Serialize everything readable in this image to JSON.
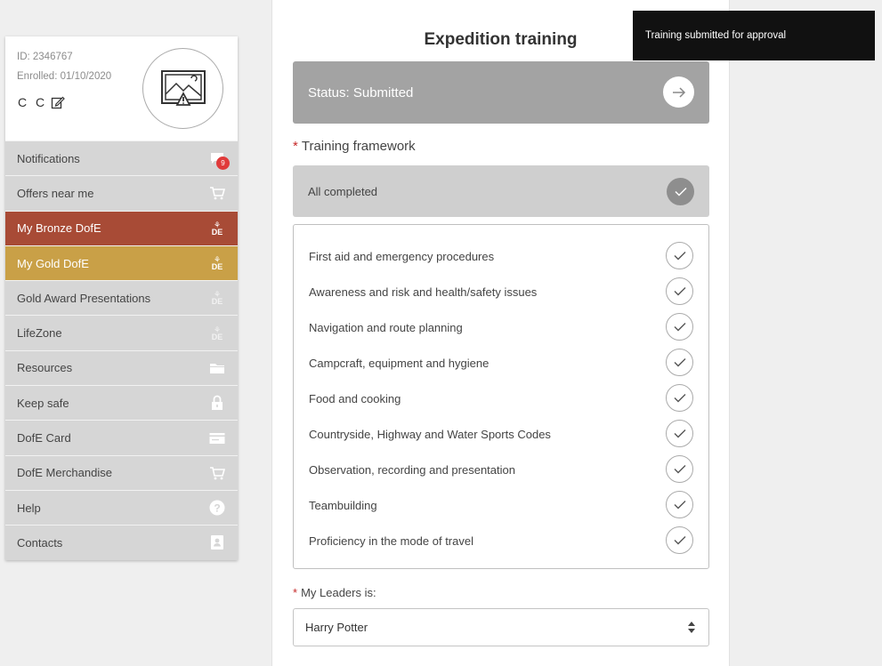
{
  "profile": {
    "id_text": "ID: 2346767",
    "enrolled_text": "Enrolled: 01/10/2020",
    "name": "C C",
    "avatar_icon": "broken-image-icon"
  },
  "nav": {
    "items": [
      {
        "label": "Notifications",
        "icon": "message-icon",
        "badge": "9"
      },
      {
        "label": "Offers near me",
        "icon": "cart-icon"
      },
      {
        "label": "My Bronze DofE",
        "icon": "dofe-logo-icon"
      },
      {
        "label": "My Gold DofE",
        "icon": "dofe-logo-icon"
      },
      {
        "label": "Gold Award Presentations",
        "icon": "dofe-logo-icon"
      },
      {
        "label": "LifeZone",
        "icon": "dofe-logo-icon"
      },
      {
        "label": "Resources",
        "icon": "folder-icon"
      },
      {
        "label": "Keep safe",
        "icon": "lock-icon"
      },
      {
        "label": "DofE Card",
        "icon": "card-icon"
      },
      {
        "label": "DofE Merchandise",
        "icon": "cart-icon"
      },
      {
        "label": "Help",
        "icon": "help-icon"
      },
      {
        "label": "Contacts",
        "icon": "contacts-icon"
      }
    ],
    "dofe_mark": "DE",
    "colors": {
      "bronze": "#a84b36",
      "gold": "#c9a047",
      "default": "#d6d6d6"
    }
  },
  "main": {
    "title": "Expedition training",
    "status": "Status: Submitted",
    "required_mark": "*",
    "framework_label": "Training framework",
    "all_completed": "All completed",
    "framework_items": [
      "First aid and emergency procedures",
      "Awareness and risk and health/safety issues",
      "Navigation and route planning",
      "Campcraft, equipment and hygiene",
      "Food and cooking",
      "Countryside, Highway and Water Sports Codes",
      "Observation, recording and presentation",
      "Teambuilding",
      "Proficiency in the mode of travel"
    ],
    "leaders_label": "My Leaders is:",
    "leader_value": "Harry Potter"
  },
  "toast": {
    "message": "Training submitted for approval"
  }
}
